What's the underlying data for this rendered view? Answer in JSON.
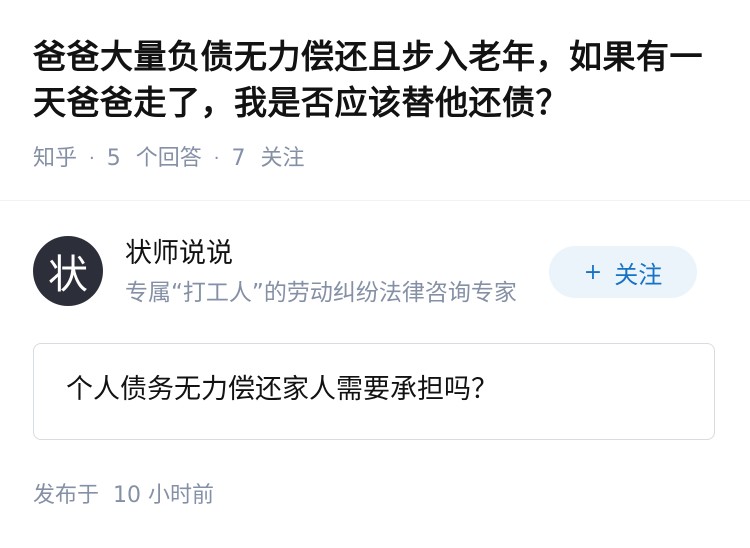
{
  "question": {
    "title": "爸爸大量负债无力偿还且步入老年，如果有一天爸爸走了，我是否应该替他还债？"
  },
  "meta": {
    "source": "知乎",
    "separator": "·",
    "answers_count": "5",
    "answers_label": "个回答",
    "followers_count": "7",
    "followers_label": "关注"
  },
  "author": {
    "avatar_char": "状",
    "name": "状师说说",
    "bio": "专属“打工人”的劳动纠纷法律咨询专家",
    "follow_icon": "+",
    "follow_label": "关注"
  },
  "answer": {
    "text": "个人债务无力偿还家人需要承担吗？"
  },
  "published": {
    "label": "发布于",
    "time": "10 小时前"
  },
  "colors": {
    "accent": "#1772c6",
    "follow_bg": "#ebf4fb",
    "muted": "#8590a6",
    "avatar_bg": "#2c2f3a"
  }
}
